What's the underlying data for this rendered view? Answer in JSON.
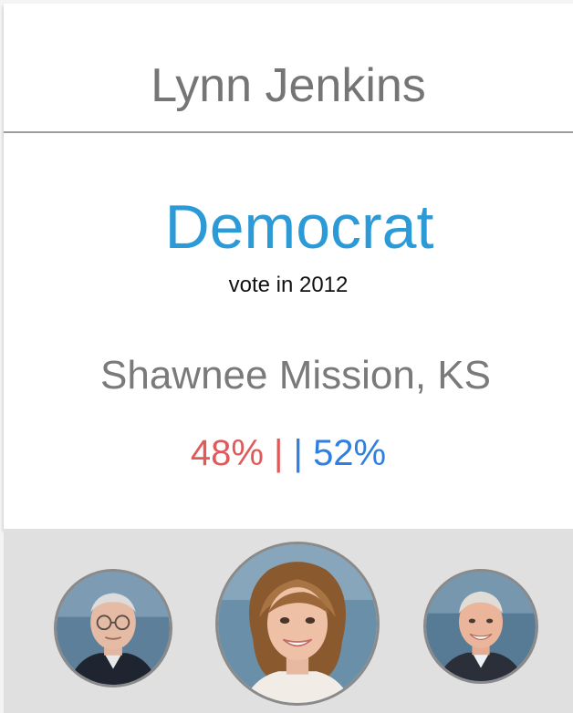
{
  "card": {
    "name": "Lynn Jenkins",
    "party": "Democrat",
    "vote_year": "vote in 2012",
    "district": "Shawnee Mission, KS",
    "results": {
      "dem": "48%",
      "sep_left": " |",
      "sep_right": " | ",
      "rep": "52%"
    }
  },
  "colors": {
    "party_blue": "#2b9ad6",
    "dem_red": "#e05a5a",
    "rep_blue": "#2e7fe0",
    "tray": "#e0e0e0"
  },
  "carousel": {
    "items": [
      {
        "icon": "portrait-older-man-glasses-icon"
      },
      {
        "icon": "portrait-woman-selected-icon"
      },
      {
        "icon": "portrait-man-smiling-icon"
      }
    ]
  }
}
